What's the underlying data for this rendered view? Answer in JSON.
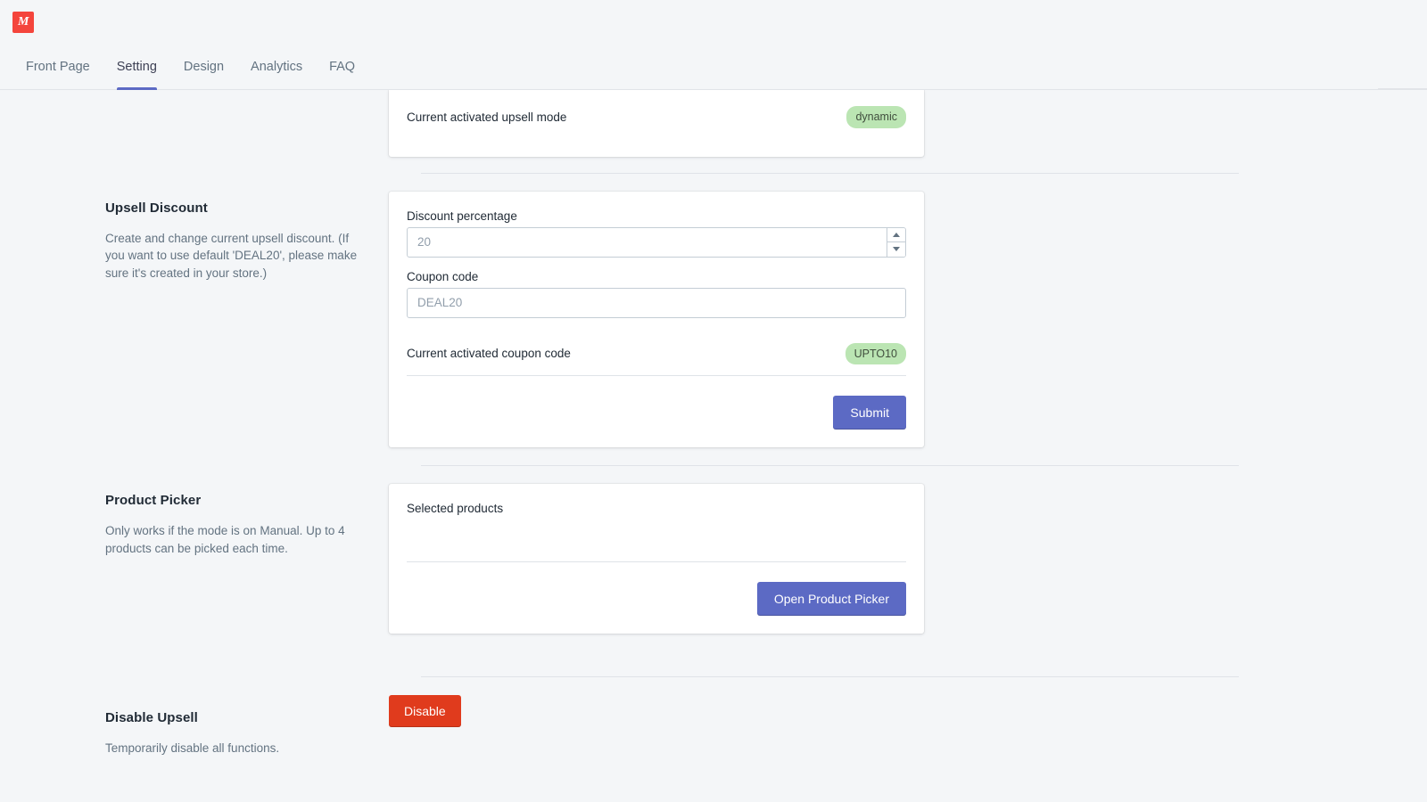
{
  "app": {
    "logo_text": "M",
    "brand_color": "#f4453c"
  },
  "nav": {
    "tabs": [
      {
        "label": "Front Page",
        "active": false
      },
      {
        "label": "Setting",
        "active": true
      },
      {
        "label": "Design",
        "active": false
      },
      {
        "label": "Analytics",
        "active": false
      },
      {
        "label": "FAQ",
        "active": false
      }
    ],
    "active_indicator_color": "#5c6ac4"
  },
  "upsell_mode_card": {
    "status_label": "Current activated upsell mode",
    "status_badge": "dynamic",
    "badge_bg": "#bbe5b3",
    "badge_fg": "#414f3e"
  },
  "upsell_discount": {
    "title": "Upsell Discount",
    "description": "Create and change current upsell discount. (If you want to use default 'DEAL20', please make sure it's created in your store.)",
    "discount_field": {
      "label": "Discount percentage",
      "value": "",
      "placeholder": "20"
    },
    "coupon_field": {
      "label": "Coupon code",
      "value": "",
      "placeholder": "DEAL20"
    },
    "status_label": "Current activated coupon code",
    "status_badge": "UPTO10",
    "submit_label": "Submit",
    "submit_color": "#5c6ac4"
  },
  "product_picker": {
    "title": "Product Picker",
    "description": "Only works if the mode is on Manual. Up to 4 products can be picked each time.",
    "selected_label": "Selected products",
    "selected_items": "",
    "open_button_label": "Open Product Picker",
    "open_button_color": "#5c6ac4"
  },
  "disable_upsell": {
    "title": "Disable Upsell",
    "description": "Temporarily disable all functions.",
    "button_label": "Disable",
    "button_color": "#e03b1d"
  }
}
